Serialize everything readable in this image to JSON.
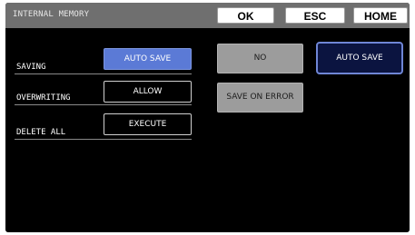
{
  "header": {
    "title": "INTERNAL MEMORY",
    "ok_label": "OK",
    "esc_label": "ESC",
    "home_label": "HOME"
  },
  "settings": {
    "saving": {
      "label": "SAVING",
      "value": "AUTO SAVE"
    },
    "overwriting": {
      "label": "OVERWRITING",
      "value": "ALLOW"
    },
    "delete_all": {
      "label": "DELETE ALL",
      "value": "EXECUTE"
    }
  },
  "options": {
    "no": "NO",
    "auto_save": "AUTO SAVE",
    "save_on_error": "SAVE ON ERROR"
  },
  "colors": {
    "selected": "#5b7ad6",
    "highlight_border": "#6f86d6",
    "header_bg": "#6f6f6f",
    "screen_bg": "#000000"
  }
}
